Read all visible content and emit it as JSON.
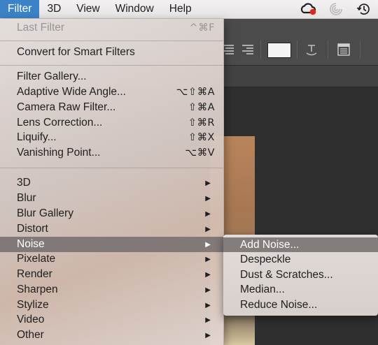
{
  "menubar": {
    "items": [
      {
        "label": "Filter",
        "active": true
      },
      {
        "label": "3D"
      },
      {
        "label": "View"
      },
      {
        "label": "Window"
      },
      {
        "label": "Help"
      }
    ],
    "tray_icons": [
      "creative-cloud-icon",
      "sync-spiral-icon",
      "time-machine-icon"
    ]
  },
  "filter_menu": {
    "last_filter": {
      "label": "Last Filter",
      "shortcut": "^⌘F"
    },
    "convert_smart": {
      "label": "Convert for Smart Filters"
    },
    "filters": [
      {
        "label": "Filter Gallery...",
        "shortcut": ""
      },
      {
        "label": "Adaptive Wide Angle...",
        "shortcut": "⌥⇧⌘A"
      },
      {
        "label": "Camera Raw Filter...",
        "shortcut": "⇧⌘A"
      },
      {
        "label": "Lens Correction...",
        "shortcut": "⇧⌘R"
      },
      {
        "label": "Liquify...",
        "shortcut": "⇧⌘X"
      },
      {
        "label": "Vanishing Point...",
        "shortcut": "⌥⌘V"
      }
    ],
    "submenus": [
      {
        "label": "3D",
        "arrow": "▶"
      },
      {
        "label": "Blur",
        "arrow": "▶"
      },
      {
        "label": "Blur Gallery",
        "arrow": "▶"
      },
      {
        "label": "Distort",
        "arrow": "▶"
      },
      {
        "label": "Noise",
        "arrow": "▶",
        "highlighted": true
      },
      {
        "label": "Pixelate",
        "arrow": "▶"
      },
      {
        "label": "Render",
        "arrow": "▶"
      },
      {
        "label": "Sharpen",
        "arrow": "▶"
      },
      {
        "label": "Stylize",
        "arrow": "▶"
      },
      {
        "label": "Video",
        "arrow": "▶"
      },
      {
        "label": "Other",
        "arrow": "▶"
      }
    ]
  },
  "noise_submenu": {
    "items": [
      {
        "label": "Add Noise...",
        "highlighted": true
      },
      {
        "label": "Despeckle"
      },
      {
        "label": "Dust & Scratches..."
      },
      {
        "label": "Median..."
      },
      {
        "label": "Reduce Noise..."
      }
    ]
  },
  "colors": {
    "menubar_active": "#3b82c7",
    "menu_highlight": "#767070"
  }
}
